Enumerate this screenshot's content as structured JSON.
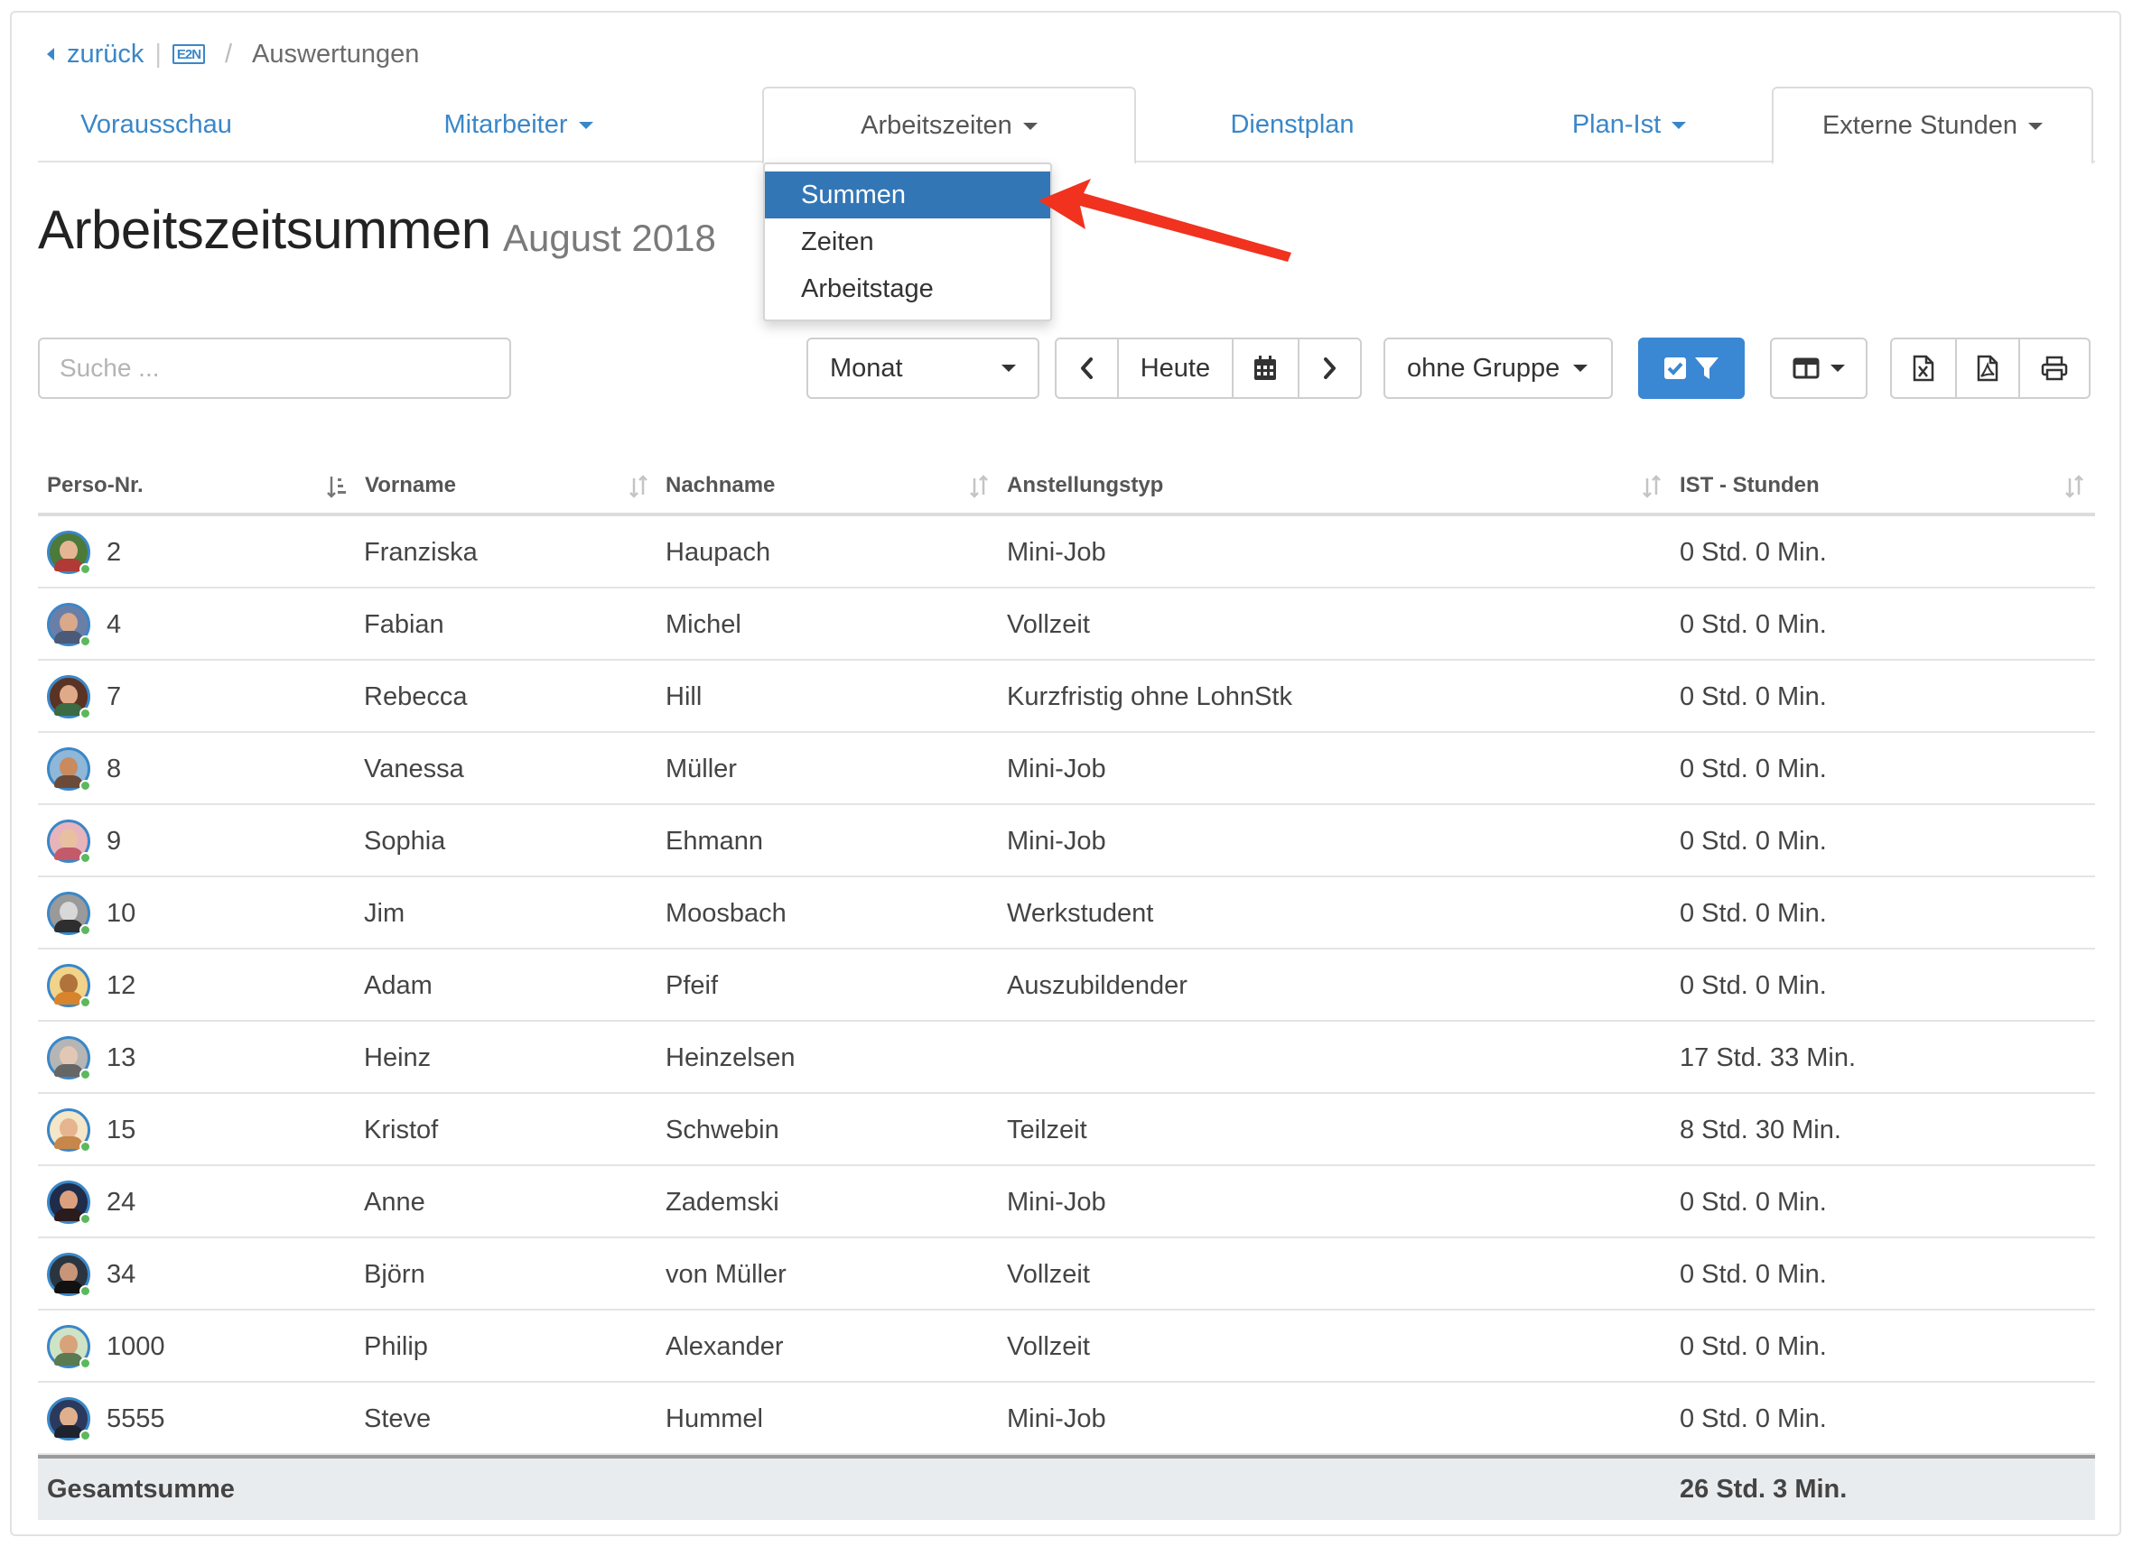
{
  "breadcrumb": {
    "back_label": "zurück",
    "logo_text": "E2N",
    "current": "Auswertungen"
  },
  "tabs": [
    {
      "label": "Vorausschau",
      "caret": false
    },
    {
      "label": "Mitarbeiter",
      "caret": true
    },
    {
      "label": "Arbeitszeiten",
      "caret": true,
      "active": true
    },
    {
      "label": "Dienstplan",
      "caret": false
    },
    {
      "label": "Plan-Ist",
      "caret": true
    },
    {
      "label": "Externe Stunden",
      "caret": true,
      "active": true
    }
  ],
  "dropdown": {
    "items": [
      {
        "label": "Summen",
        "selected": true
      },
      {
        "label": "Zeiten",
        "selected": false
      },
      {
        "label": "Arbeitstage",
        "selected": false
      }
    ]
  },
  "page": {
    "title": "Arbeitszeitsummen",
    "period": "August 2018"
  },
  "toolbar": {
    "search_placeholder": "Suche ...",
    "period_select": "Monat",
    "today_label": "Heute",
    "group_select": "ohne Gruppe"
  },
  "table": {
    "columns": [
      "Perso-Nr.",
      "Vorname",
      "Nachname",
      "Anstellungstyp",
      "IST - Stunden"
    ],
    "rows": [
      {
        "nr": "2",
        "vorname": "Franziska",
        "nachname": "Haupach",
        "typ": "Mini-Job",
        "ist": "0 Std. 0 Min."
      },
      {
        "nr": "4",
        "vorname": "Fabian",
        "nachname": "Michel",
        "typ": "Vollzeit",
        "ist": "0 Std. 0 Min."
      },
      {
        "nr": "7",
        "vorname": "Rebecca",
        "nachname": "Hill",
        "typ": "Kurzfristig ohne LohnStk",
        "ist": "0 Std. 0 Min."
      },
      {
        "nr": "8",
        "vorname": "Vanessa",
        "nachname": "Müller",
        "typ": "Mini-Job",
        "ist": "0 Std. 0 Min."
      },
      {
        "nr": "9",
        "vorname": "Sophia",
        "nachname": "Ehmann",
        "typ": "Mini-Job",
        "ist": "0 Std. 0 Min."
      },
      {
        "nr": "10",
        "vorname": "Jim",
        "nachname": "Moosbach",
        "typ": "Werkstudent",
        "ist": "0 Std. 0 Min."
      },
      {
        "nr": "12",
        "vorname": "Adam",
        "nachname": "Pfeif",
        "typ": "Auszubildender",
        "ist": "0 Std. 0 Min."
      },
      {
        "nr": "13",
        "vorname": "Heinz",
        "nachname": "Heinzelsen",
        "typ": "",
        "ist": "17 Std. 33 Min."
      },
      {
        "nr": "15",
        "vorname": "Kristof",
        "nachname": "Schwebin",
        "typ": "Teilzeit",
        "ist": "8 Std. 30 Min."
      },
      {
        "nr": "24",
        "vorname": "Anne",
        "nachname": "Zademski",
        "typ": "Mini-Job",
        "ist": "0 Std. 0 Min."
      },
      {
        "nr": "34",
        "vorname": "Björn",
        "nachname": "von Müller",
        "typ": "Vollzeit",
        "ist": "0 Std. 0 Min."
      },
      {
        "nr": "1000",
        "vorname": "Philip",
        "nachname": "Alexander",
        "typ": "Vollzeit",
        "ist": "0 Std. 0 Min."
      },
      {
        "nr": "5555",
        "vorname": "Steve",
        "nachname": "Hummel",
        "typ": "Mini-Job",
        "ist": "0 Std. 0 Min."
      }
    ],
    "total_label": "Gesamtsumme",
    "total_value": "26 Std. 3 Min."
  },
  "colors": {
    "link": "#3a87c8",
    "primary": "#3a87d3",
    "dropdown_active": "#3376b6",
    "arrow": "#f0321f"
  }
}
